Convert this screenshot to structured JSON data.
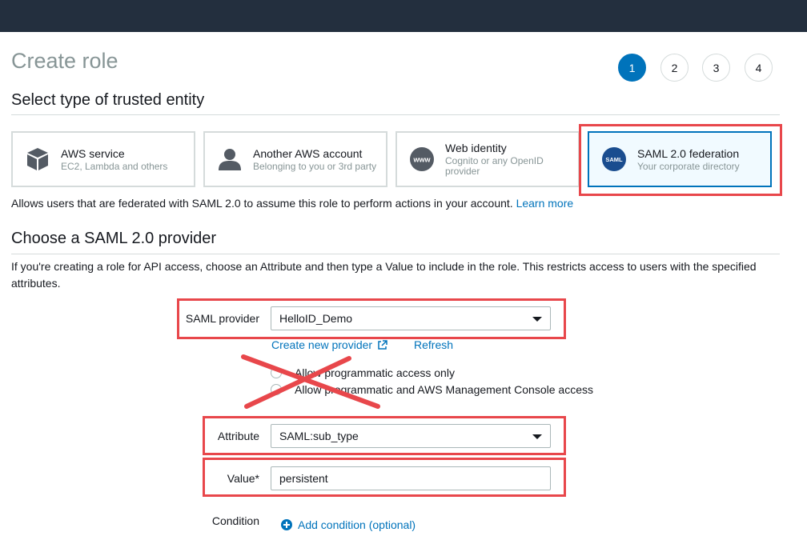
{
  "page": {
    "title": "Create role"
  },
  "steps": [
    "1",
    "2",
    "3",
    "4"
  ],
  "active_step": 1,
  "trusted_entity": {
    "heading": "Select type of trusted entity",
    "tiles": [
      {
        "label": "AWS service",
        "sub": "EC2, Lambda and others",
        "icon": "cube-icon"
      },
      {
        "label": "Another AWS account",
        "sub": "Belonging to you or 3rd party",
        "icon": "user-icon"
      },
      {
        "label": "Web identity",
        "sub": "Cognito or any OpenID provider",
        "icon": "globe-www-icon"
      },
      {
        "label": "SAML 2.0 federation",
        "sub": "Your corporate directory",
        "icon": "saml-icon",
        "icon_text": "SAML",
        "selected": true
      }
    ],
    "description": "Allows users that are federated with SAML 2.0 to assume this role to perform actions in your account.",
    "learn_more": "Learn more"
  },
  "provider_section": {
    "heading": "Choose a SAML 2.0 provider",
    "description": "If you're creating a role for API access, choose an Attribute and then type a Value to include in the role. This restricts access to users with the specified attributes."
  },
  "form": {
    "saml_provider_label": "SAML provider",
    "saml_provider_value": "HelloID_Demo",
    "create_provider_link": "Create new provider",
    "refresh_link": "Refresh",
    "access_options": [
      "Allow programmatic access only",
      "Allow programmatic and AWS Management Console access"
    ],
    "attribute_label": "Attribute",
    "attribute_value": "SAML:sub_type",
    "value_label": "Value*",
    "value_value": "persistent",
    "condition_label": "Condition",
    "add_condition": "Add condition (optional)"
  },
  "colors": {
    "accent": "#0073bb",
    "highlight": "#e8474b",
    "topbar": "#232f3e"
  }
}
